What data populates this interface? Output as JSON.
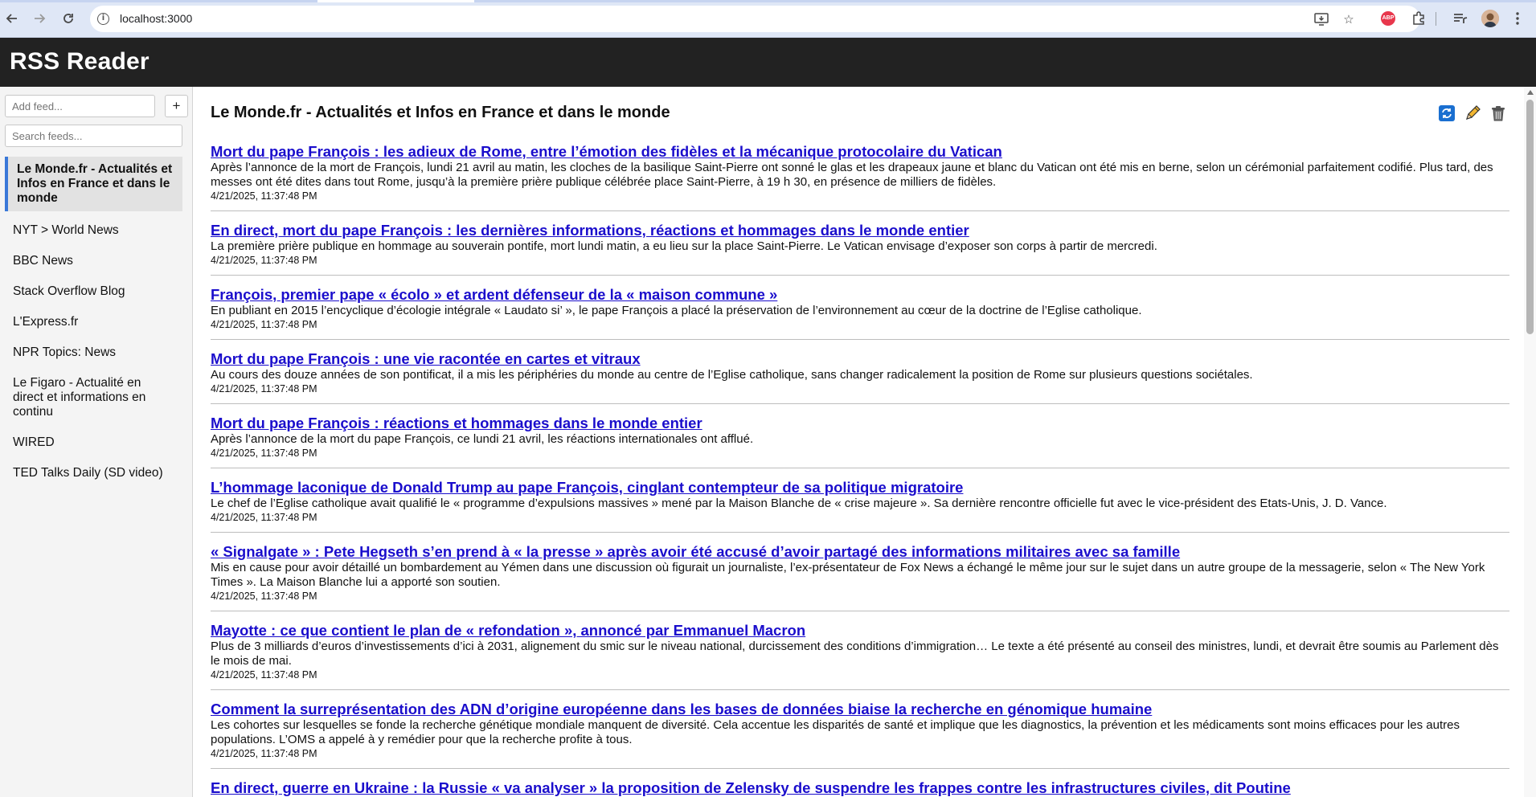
{
  "browser": {
    "url": "localhost:3000",
    "back_icon": "arrow-left-icon",
    "forward_icon": "arrow-right-icon",
    "reload_icon": "reload-icon",
    "abp_label": "ABP"
  },
  "app": {
    "title": "RSS Reader"
  },
  "sidebar": {
    "add_placeholder": "Add feed...",
    "add_button": "+",
    "search_placeholder": "Search feeds...",
    "feeds": [
      {
        "label": "Le Monde.fr - Actualités et Infos en France et dans le monde",
        "active": true
      },
      {
        "label": "NYT > World News"
      },
      {
        "label": "BBC News"
      },
      {
        "label": "Stack Overflow Blog"
      },
      {
        "label": "L'Express.fr"
      },
      {
        "label": "NPR Topics: News"
      },
      {
        "label": "Le Figaro - Actualité en direct et informations en continu"
      },
      {
        "label": "WIRED"
      },
      {
        "label": "TED Talks Daily (SD video)"
      }
    ]
  },
  "main": {
    "feed_title": "Le Monde.fr - Actualités et Infos en France et dans le monde",
    "actions": [
      "refresh-icon",
      "pencil-icon",
      "trash-icon"
    ],
    "articles": [
      {
        "title": "Mort du pape François : les adieux de Rome, entre l’émotion des fidèles et la mécanique protocolaire du Vatican",
        "description": "Après l’annonce de la mort de François, lundi 21 avril au matin, les cloches de la basilique Saint-Pierre ont sonné le glas et les drapeaux jaune et blanc du Vatican ont été mis en berne, selon un cérémonial parfaitement codifié. Plus tard, des messes ont été dites dans tout Rome, jusqu’à la première prière publique célébrée place Saint-Pierre, à 19 h 30, en présence de milliers de fidèles.",
        "date": "4/21/2025, 11:37:48 PM"
      },
      {
        "title": "En direct, mort du pape François : les dernières informations, réactions et hommages dans le monde entier",
        "description": "La première prière publique en hommage au souverain pontife, mort lundi matin, a eu lieu sur la place Saint-Pierre. Le Vatican envisage d’exposer son corps à partir de mercredi.",
        "date": "4/21/2025, 11:37:48 PM"
      },
      {
        "title": "François, premier pape « écolo » et ardent défenseur de la « maison commune »",
        "description": "En publiant en 2015 l’encyclique d’écologie intégrale « Laudato si’ », le pape François a placé la préservation de l’environnement au cœur de la doctrine de l’Eglise catholique.",
        "date": "4/21/2025, 11:37:48 PM"
      },
      {
        "title": "Mort du pape François : une vie racontée en cartes et vitraux",
        "description": "Au cours des douze années de son pontificat, il a mis les périphéries du monde au centre de l’Eglise catholique, sans changer radicalement la position de Rome sur plusieurs questions sociétales.",
        "date": "4/21/2025, 11:37:48 PM"
      },
      {
        "title": "Mort du pape François : réactions et hommages dans le monde entier",
        "description": "Après l’annonce de la mort du pape François, ce lundi 21 avril, les réactions internationales ont afflué.",
        "date": "4/21/2025, 11:37:48 PM"
      },
      {
        "title": "L’hommage laconique de Donald Trump au pape François, cinglant contempteur de sa politique migratoire",
        "description": "Le chef de l’Eglise catholique avait qualifié le « programme d’expulsions massives » mené par la Maison Blanche de « crise majeure ». Sa dernière rencontre officielle fut avec le vice-président des Etats-Unis, J. D. Vance.",
        "date": "4/21/2025, 11:37:48 PM"
      },
      {
        "title": "« Signalgate » : Pete Hegseth s’en prend à « la presse » après avoir été accusé d’avoir partagé des informations militaires avec sa famille",
        "description": "Mis en cause pour avoir détaillé un bombardement au Yémen dans une discussion où figurait un journaliste, l’ex-présentateur de Fox News a échangé le même jour sur le sujet dans un autre groupe de la messagerie, selon « The New York Times ». La Maison Blanche lui a apporté son soutien.",
        "date": "4/21/2025, 11:37:48 PM"
      },
      {
        "title": "Mayotte : ce que contient le plan de « refondation », annoncé par Emmanuel Macron",
        "description": "Plus de 3 milliards d’euros d’investissements d’ici à 2031, alignement du smic sur le niveau national, durcissement des conditions d’immigration… Le texte a été présenté au conseil des ministres, lundi, et devrait être soumis au Parlement dès le mois de mai.",
        "date": "4/21/2025, 11:37:48 PM"
      },
      {
        "title": "Comment la surreprésentation des ADN d’origine européenne dans les bases de données biaise la recherche en génomique humaine",
        "description": "Les cohortes sur lesquelles se fonde la recherche génétique mondiale manquent de diversité. Cela accentue les disparités de santé et implique que les diagnostics, la prévention et les médicaments sont moins efficaces pour les autres populations. L’OMS a appelé à y remédier pour que la recherche profite à tous.",
        "date": "4/21/2025, 11:37:48 PM"
      },
      {
        "title": "En direct, guerre en Ukraine : la Russie « va analyser » la proposition de Zelensky de suspendre les frappes contre les infrastructures civiles, dit Poutine",
        "description": "",
        "date": ""
      }
    ]
  }
}
